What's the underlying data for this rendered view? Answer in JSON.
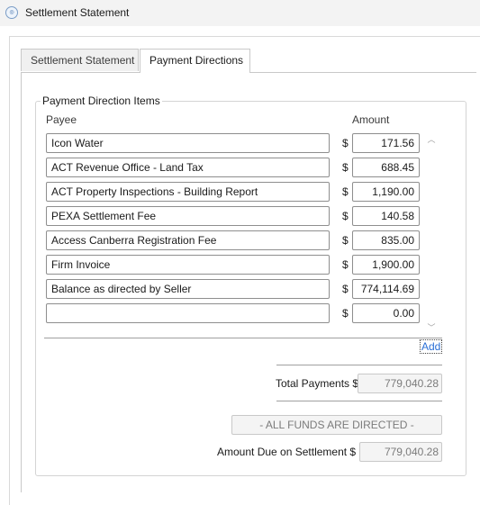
{
  "window": {
    "title": "Settlement Statement",
    "icon": "app-icon"
  },
  "tabs": [
    {
      "label": "Settlement Statement",
      "active": false
    },
    {
      "label": "Payment Directions",
      "active": true
    }
  ],
  "group": {
    "title": "Payment Direction Items",
    "payee_header": "Payee",
    "amount_header": "Amount",
    "currency_symbol": "$",
    "items": [
      {
        "payee": "Icon Water",
        "amount": "171.56"
      },
      {
        "payee": "ACT Revenue Office - Land Tax",
        "amount": "688.45"
      },
      {
        "payee": "ACT Property Inspections - Building Report",
        "amount": "1,190.00"
      },
      {
        "payee": "PEXA Settlement Fee",
        "amount": "140.58"
      },
      {
        "payee": "Access Canberra Registration Fee",
        "amount": "835.00"
      },
      {
        "payee": "Firm Invoice",
        "amount": "1,900.00"
      },
      {
        "payee": "Balance as directed by Seller",
        "amount": "774,114.69"
      },
      {
        "payee": "",
        "amount": "0.00"
      }
    ],
    "add_label": "Add"
  },
  "totals": {
    "total_payments_label": "Total Payments $",
    "total_payments_value": "779,040.28",
    "status_text": "- ALL FUNDS ARE DIRECTED -",
    "amount_due_label": "Amount Due on Settlement $",
    "amount_due_value": "779,040.28"
  }
}
